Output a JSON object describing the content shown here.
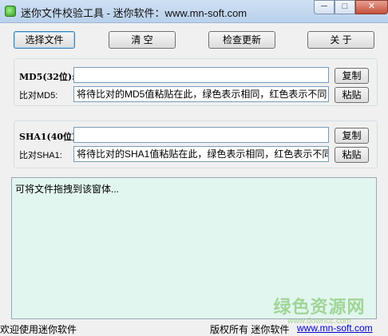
{
  "window": {
    "title": "迷你文件校验工具 - 迷你软件：www.mn-soft.com",
    "min_glyph": "─",
    "max_glyph": "□",
    "close_glyph": "✕"
  },
  "toolbar": {
    "select_file": "选择文件",
    "clear": "清  空",
    "check_update": "检查更新",
    "about": "关  于"
  },
  "md5": {
    "label": "MD5(32位):",
    "compare_label": "比对MD5:",
    "hash_value": "",
    "compare_value": "将待比对的MD5值粘贴在此，绿色表示相同，红色表示不同",
    "copy_label": "复制",
    "paste_label": "粘贴"
  },
  "sha1": {
    "label": "SHA1(40位):",
    "compare_label": "比对SHA1:",
    "hash_value": "",
    "compare_value": "将待比对的SHA1值粘贴在此，绿色表示相同，红色表示不同",
    "copy_label": "复制",
    "paste_label": "粘贴"
  },
  "drop_area": {
    "text": "可将文件拖拽到该窗体..."
  },
  "status": {
    "welcome": "欢迎使用迷你软件",
    "copyright": "版权所有 迷你软件",
    "link": "www.mn-soft.com"
  },
  "watermark": {
    "main": "绿色资源网",
    "sub": "www.downcc.com"
  },
  "colors": {
    "drop_area_bg": "#e1f6ee",
    "link": "#0000cc",
    "close_button": "#c4513a"
  }
}
